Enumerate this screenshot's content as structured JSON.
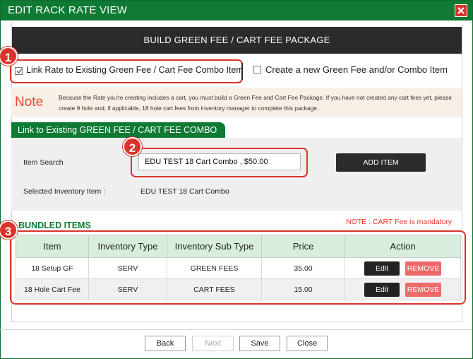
{
  "window": {
    "title": "EDIT RACK RATE VIEW",
    "close_icon": "close-icon"
  },
  "header": {
    "title": "BUILD GREEN FEE / CART FEE PACKAGE"
  },
  "options": {
    "link_existing": {
      "label": "Link Rate to Existing Green Fee / Cart Fee Combo Item",
      "checked": true
    },
    "create_new": {
      "label": "Create a new Green Fee and/or Combo Item",
      "checked": false
    }
  },
  "note": {
    "title": "Note",
    "text": "Because the Rate you're creating includes a cart, you must build a Green Fee and Cart Fee Package. If you have not created any cart fees yet, please create 9 hole and, if applicable, 18 hole cart fees from inventory manager to complete this package."
  },
  "link_section": {
    "title": "Link to Existing GREEN FEE / CART FEE COMBO",
    "item_search_label": "Item Search",
    "item_search_value": "EDU TEST 18 Cart Combo ,  $50.00",
    "add_item_label": "ADD ITEM",
    "selected_label": "Selected Inventory Item :",
    "selected_value": "EDU TEST 18 Cart Combo"
  },
  "bundled": {
    "title": "BUNDLED ITEMS",
    "note": "NOTE : CART Fee is mandatory",
    "columns": [
      "Item",
      "Inventory Type",
      "Inventory Sub Type",
      "Price",
      "Action"
    ],
    "rows": [
      {
        "item": "18 Setup GF",
        "type": "SERV",
        "sub_type": "GREEN FEES",
        "price": "35.00",
        "edit": "Edit",
        "remove": "REMOVE"
      },
      {
        "item": "18 Hole Cart Fee",
        "type": "SERV",
        "sub_type": "CART FEES",
        "price": "15.00",
        "edit": "Edit",
        "remove": "REMOVE"
      }
    ]
  },
  "footer": {
    "back": "Back",
    "next": "Next",
    "save": "Save",
    "close": "Close"
  },
  "callouts": [
    "1",
    "2",
    "3"
  ],
  "colors": {
    "primary_green": "#0e7a34",
    "callout_red": "#d9342c",
    "remove_red": "#ee6a6a",
    "dark": "#2b2b2b"
  }
}
